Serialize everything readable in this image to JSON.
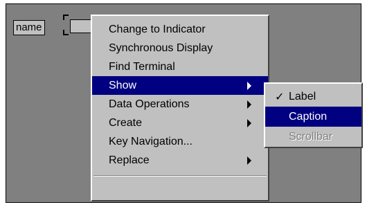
{
  "control": {
    "label": "name"
  },
  "context_menu": {
    "items": [
      {
        "label": "Change to Indicator",
        "submenu": false
      },
      {
        "label": "Synchronous Display",
        "submenu": false
      },
      {
        "label": "Find Terminal",
        "submenu": false
      },
      {
        "label": "Show",
        "submenu": true,
        "selected": true
      },
      {
        "label": "Data Operations",
        "submenu": true
      },
      {
        "label": "Create",
        "submenu": true
      },
      {
        "label": "Key Navigation...",
        "submenu": false
      },
      {
        "label": "Replace",
        "submenu": true
      }
    ]
  },
  "show_submenu": {
    "items": [
      {
        "label": "Label",
        "checked": true
      },
      {
        "label": "Caption",
        "selected": true
      },
      {
        "label": "Scrollbar",
        "disabled": true
      }
    ],
    "check_glyph": "✓"
  },
  "colors": {
    "background": "#808080",
    "menu": "#c0c0c0",
    "highlight": "#000080",
    "highlight_text": "#ffffff",
    "disabled_text": "#808080"
  }
}
